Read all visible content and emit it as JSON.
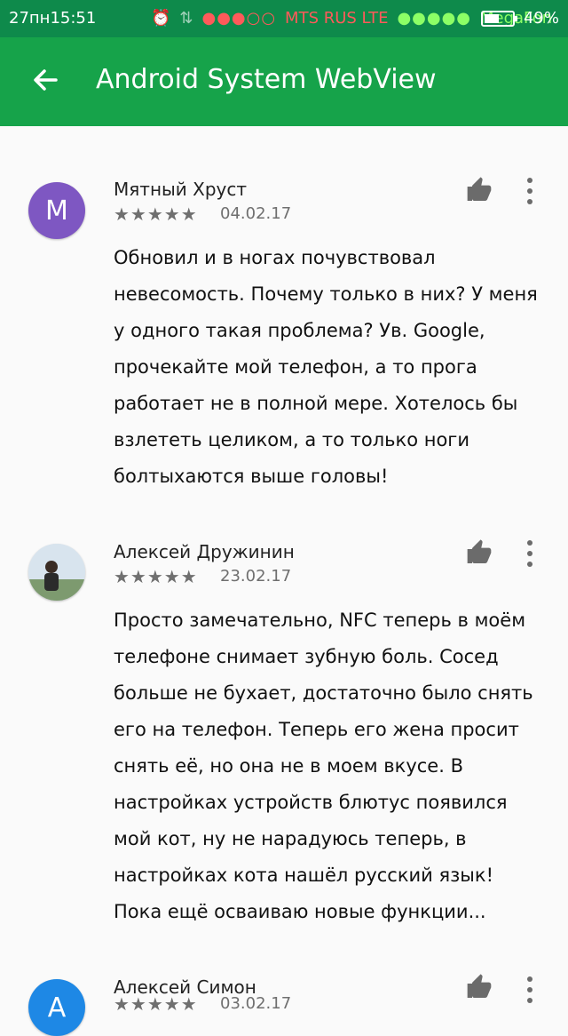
{
  "status": {
    "time": "27пн15:51",
    "carrier1": "MTS RUS LTE",
    "carrier2": "MegaFon",
    "battery": "49%",
    "battery_icon_text": "b"
  },
  "appbar": {
    "title": "Android System WebView"
  },
  "reviews": [
    {
      "avatar": "M",
      "avatar_color": "#7e57c2",
      "name": "Мятный Хруст",
      "stars": "★★★★★",
      "date": "04.02.17",
      "text": "Обновил и в ногах почувствовал невесомость. Почему только в них? У меня у одного такая проблема? Ув. Google, прочекайте мой телефон, а то прога работает не в полной мере. Хотелось бы взлететь целиком, а то только ноги болтыхаются выше головы!"
    },
    {
      "avatar": "",
      "avatar_color": "#dfe8ef",
      "name": "Алексей Дружинин",
      "stars": "★★★★★",
      "date": "23.02.17",
      "text": "Просто замечательно, NFC теперь в моём телефоне снимает зубную боль. Сосед больше не бухает, достаточно было снять его на телефон. Теперь его жена просит снять её, но она не в моем вкусе. В настройках устройств блютус появился мой кот, ну не нарадуюсь теперь, в настройках кота нашёл русский язык! Пока ещё осваиваю новые функции..."
    },
    {
      "avatar": "A",
      "avatar_color": "#1e88e5",
      "name": "Алексей Симон",
      "stars": "★★★★★",
      "date": "03.02.17",
      "text": ""
    }
  ]
}
